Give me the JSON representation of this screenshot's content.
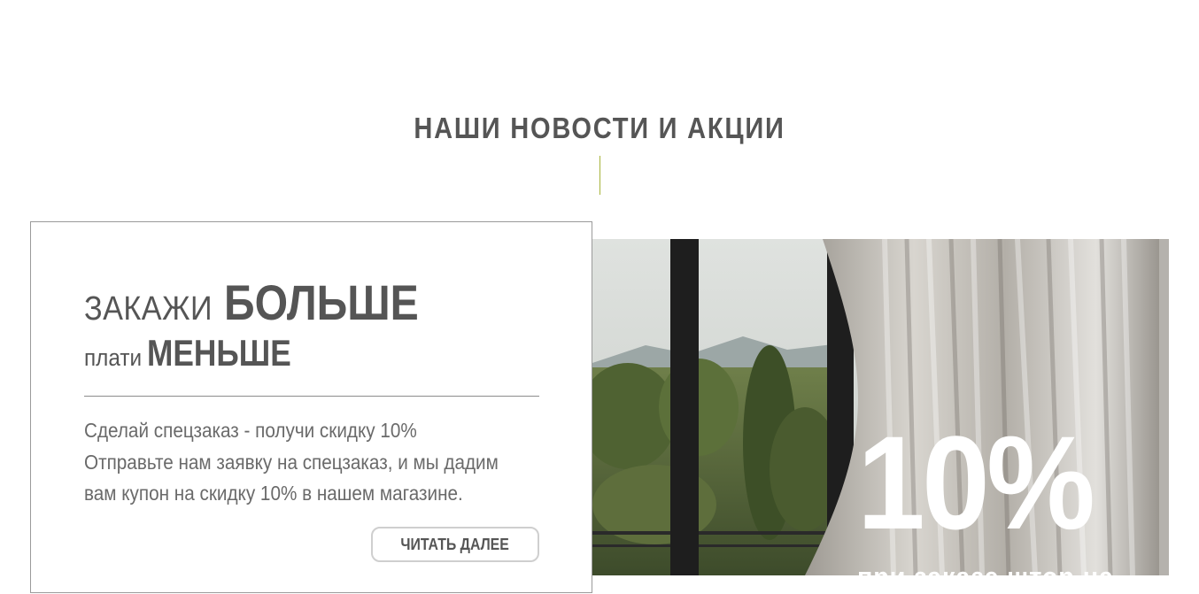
{
  "section": {
    "title": "НАШИ НОВОСТИ И АКЦИИ"
  },
  "promo": {
    "headline": {
      "line1_light": "ЗАКАЖИ",
      "line1_bold": "БОЛЬШЕ",
      "line2_light": "плати",
      "line2_bold": "МЕНЬШЕ"
    },
    "text_lines": [
      "Сделай спецзаказ - получи скидку 10%",
      "Отправьте нам заявку на спецзаказ, и мы дадим",
      "вам купон на скидку 10% в нашем магазине."
    ],
    "read_more_label": "ЧИТАТЬ ДАЛЕЕ",
    "image": {
      "discount": "10%",
      "caption": "при заказе штор на"
    }
  },
  "colors": {
    "accent": "#a7b33a",
    "heading": "#555555",
    "body_text": "#6a6a6a"
  }
}
